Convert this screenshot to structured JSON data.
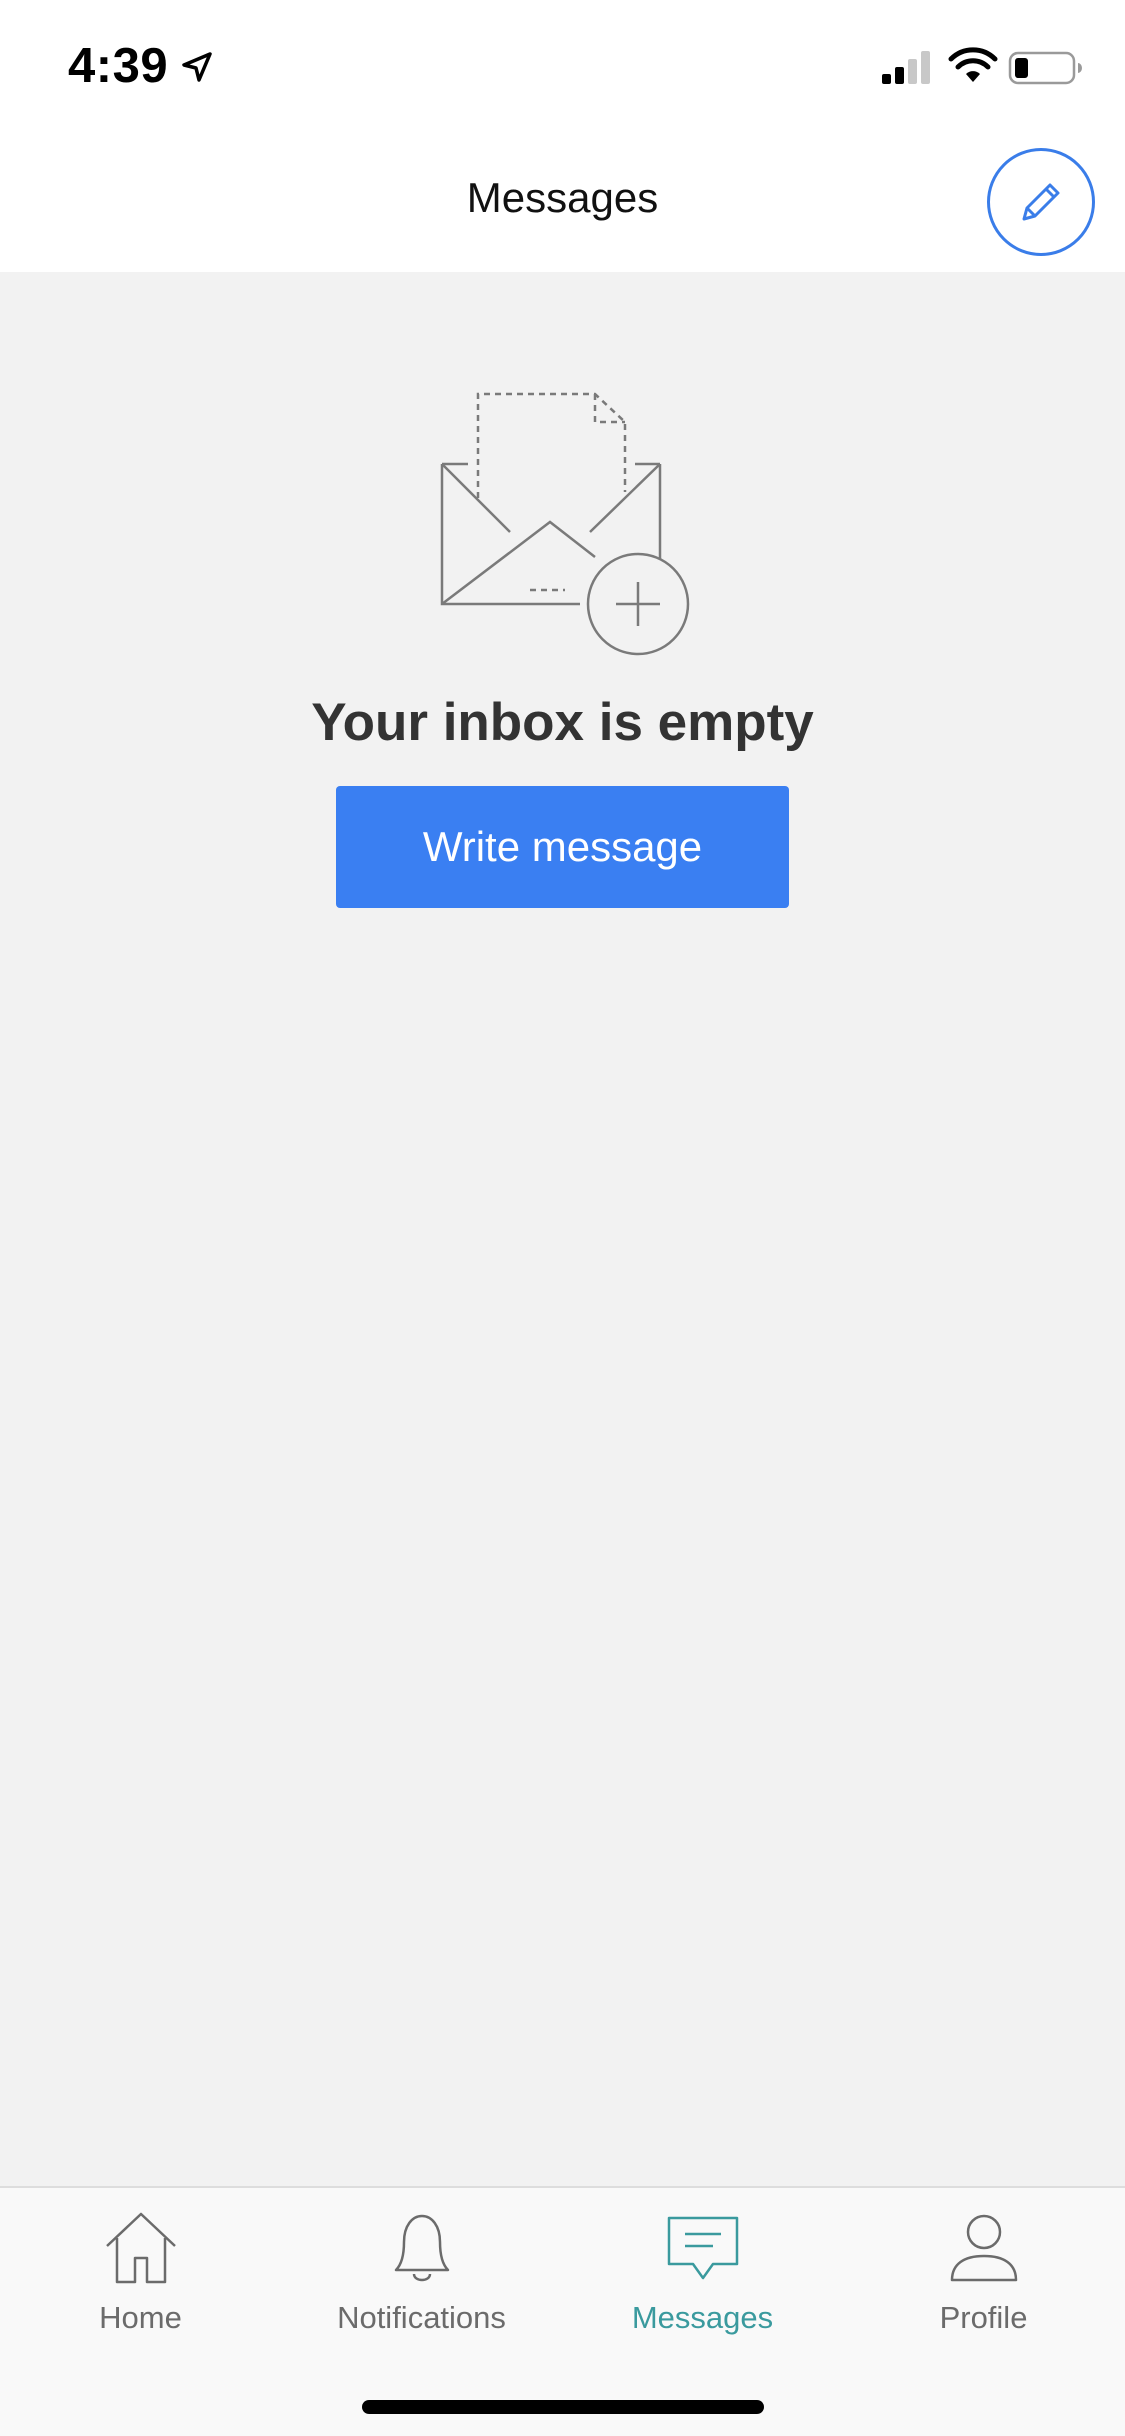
{
  "status_bar": {
    "time": "4:39",
    "icons": [
      "location-arrow-icon",
      "cellular-signal-icon",
      "wifi-icon",
      "battery-icon"
    ]
  },
  "header": {
    "title": "Messages",
    "compose_icon": "pencil-icon"
  },
  "empty_state": {
    "illustration": "envelope-plus-icon",
    "title": "Your inbox is empty",
    "button_label": "Write message"
  },
  "tab_bar": {
    "active_index": 2,
    "items": [
      {
        "label": "Home",
        "icon": "home-icon"
      },
      {
        "label": "Notifications",
        "icon": "bell-icon"
      },
      {
        "label": "Messages",
        "icon": "message-icon"
      },
      {
        "label": "Profile",
        "icon": "person-icon"
      }
    ]
  },
  "colors": {
    "accent": "#3a7ff2",
    "active_tab": "#3a9a9e",
    "inactive_tab": "#6b6b6b",
    "background": "#f2f2f2"
  }
}
